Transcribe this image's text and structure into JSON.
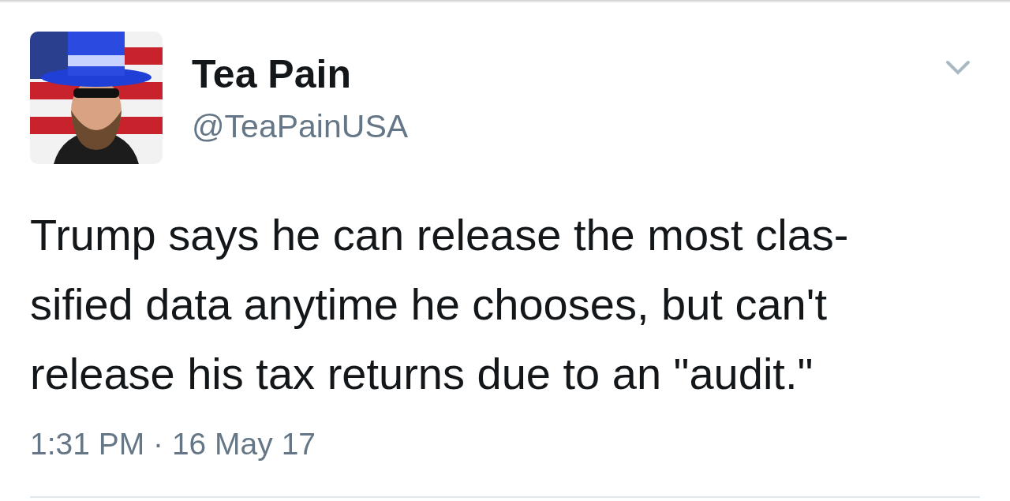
{
  "tweet": {
    "name": "Tea Pain",
    "handle": "@TeaPainUSA",
    "text_lines": [
      "Trump says he can release the most clas-",
      "sified data anytime he chooses, but can't",
      "release his tax returns due to an \"audit.\""
    ],
    "timestamp": "1:31 PM · 16 May 17"
  }
}
